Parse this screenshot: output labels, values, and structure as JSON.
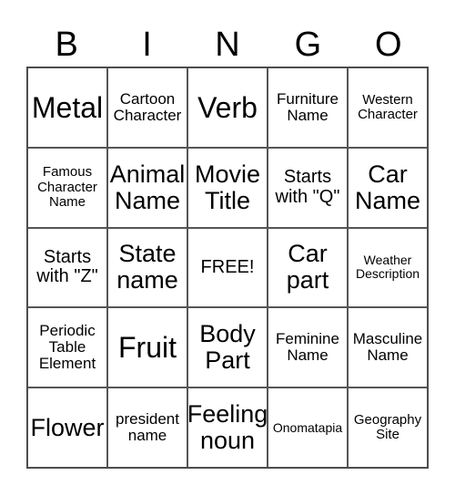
{
  "header": [
    "B",
    "I",
    "N",
    "G",
    "O"
  ],
  "cells": [
    {
      "text": "Metal",
      "size": "s-xl"
    },
    {
      "text": "Cartoon Character",
      "size": "s-s"
    },
    {
      "text": "Verb",
      "size": "s-xl"
    },
    {
      "text": "Furniture Name",
      "size": "s-s"
    },
    {
      "text": "Western Character",
      "size": "s-xs"
    },
    {
      "text": "Famous Character Name",
      "size": "s-xs"
    },
    {
      "text": "Animal Name",
      "size": "s-l"
    },
    {
      "text": "Movie Title",
      "size": "s-l"
    },
    {
      "text": "Starts with \"Q\"",
      "size": "s-m"
    },
    {
      "text": "Car Name",
      "size": "s-l"
    },
    {
      "text": "Starts with \"Z\"",
      "size": "s-m"
    },
    {
      "text": "State name",
      "size": "s-l"
    },
    {
      "text": "FREE!",
      "size": "s-m"
    },
    {
      "text": "Car part",
      "size": "s-l"
    },
    {
      "text": "Weather Description",
      "size": "s-xxs"
    },
    {
      "text": "Periodic Table Element",
      "size": "s-s"
    },
    {
      "text": "Fruit",
      "size": "s-xl"
    },
    {
      "text": "Body Part",
      "size": "s-l"
    },
    {
      "text": "Feminine Name",
      "size": "s-s"
    },
    {
      "text": "Masculine Name",
      "size": "s-s"
    },
    {
      "text": "Flower",
      "size": "s-l"
    },
    {
      "text": "president name",
      "size": "s-s"
    },
    {
      "text": "Feeling noun",
      "size": "s-l"
    },
    {
      "text": "Onomatapia",
      "size": "s-xxs"
    },
    {
      "text": "Geography Site",
      "size": "s-xs"
    }
  ]
}
